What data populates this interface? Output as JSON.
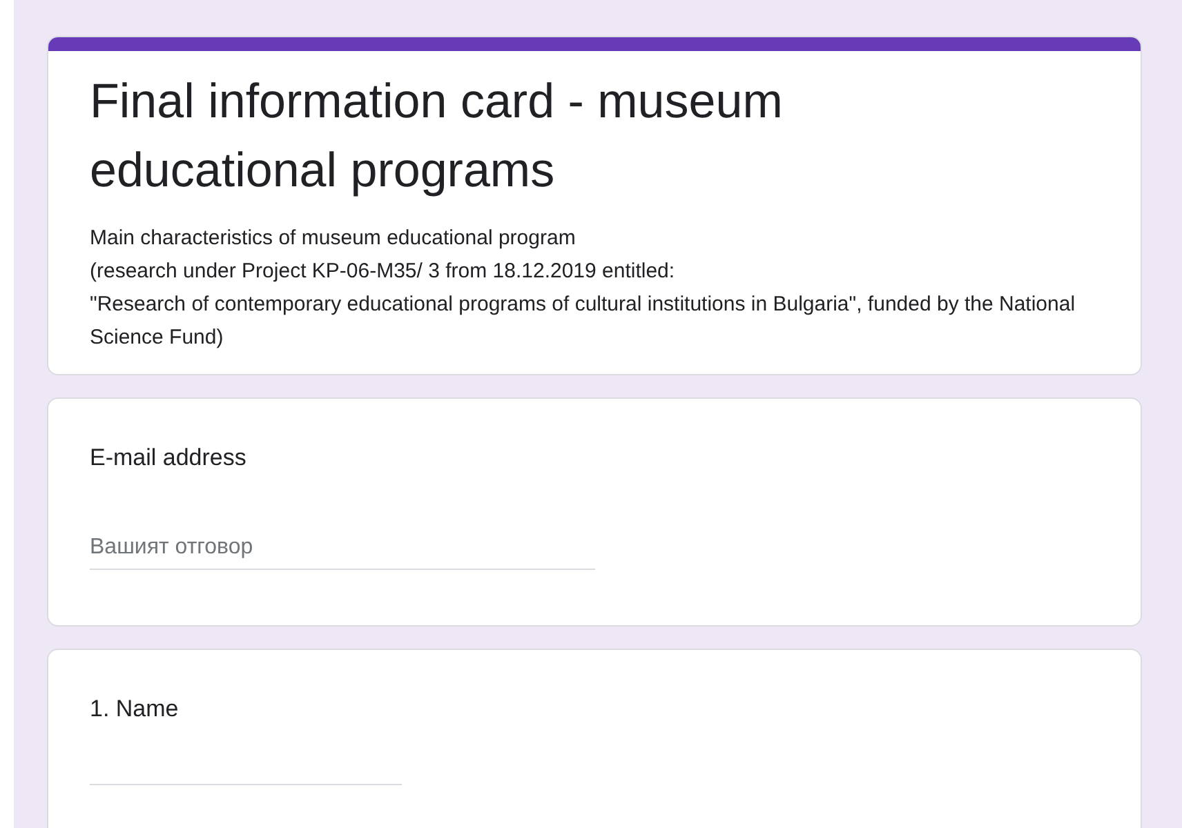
{
  "form": {
    "title": "Final information card - museum educational programs",
    "description": [
      "Main characteristics of museum educational program",
      "(research under Project KP-06-M35/ 3 from 18.12.2019 entitled:",
      "\"Research of contemporary educational programs of cultural institutions in Bulgaria\", funded by the National Science Fund)"
    ]
  },
  "questions": [
    {
      "label": "E-mail address",
      "placeholder": "Вашият отговор"
    },
    {
      "label": "1. Name"
    }
  ]
}
